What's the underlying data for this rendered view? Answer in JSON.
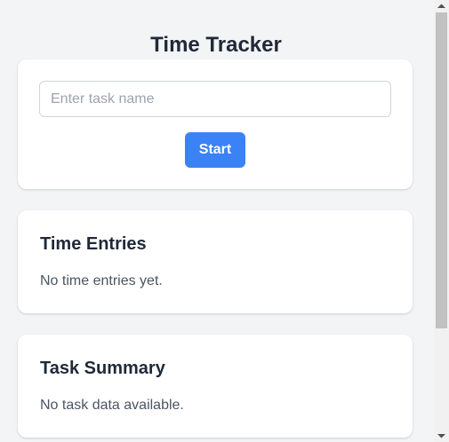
{
  "app": {
    "title": "Time Tracker"
  },
  "timer": {
    "task_input": {
      "placeholder": "Enter task name",
      "value": ""
    },
    "start_label": "Start"
  },
  "time_entries": {
    "heading": "Time Entries",
    "empty_message": "No time entries yet."
  },
  "task_summary": {
    "heading": "Task Summary",
    "empty_message": "No task data available."
  },
  "colors": {
    "page_background": "#f3f4f6",
    "card_background": "#ffffff",
    "accent": "#3b82f6",
    "heading_text": "#1f2937",
    "muted_text": "#4b5563"
  },
  "icons": {
    "scroll_up": "chevron-up-icon",
    "scroll_down": "chevron-down-icon"
  }
}
